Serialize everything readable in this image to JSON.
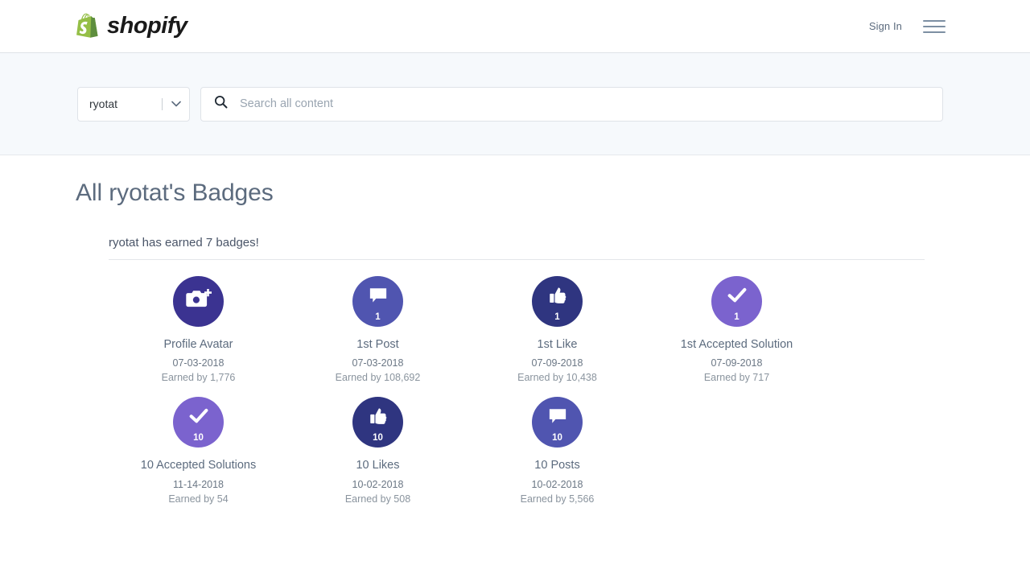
{
  "header": {
    "brand_name": "shopify",
    "brand_icon": "shopify-bag-logo",
    "brand_color": "#95BF47",
    "signin_label": "Sign In",
    "menu_icon": "hamburger-menu-icon"
  },
  "search": {
    "user_scope_value": "ryotat",
    "dropdown_icon": "chevron-down-icon",
    "search_icon": "search-icon",
    "placeholder": "Search all content",
    "value": ""
  },
  "main": {
    "page_title": "All ryotat's Badges",
    "summary": "ryotat has earned 7 badges!"
  },
  "badges": [
    {
      "name": "Profile Avatar",
      "date": "07-03-2018",
      "earned_by": "Earned by 1,776",
      "icon": "camera-plus-icon",
      "count": "",
      "color": "#3b3391"
    },
    {
      "name": "1st Post",
      "date": "07-03-2018",
      "earned_by": "Earned by 108,692",
      "icon": "speech-bubble-icon",
      "count": "1",
      "color": "#5055b0"
    },
    {
      "name": "1st Like",
      "date": "07-09-2018",
      "earned_by": "Earned by 10,438",
      "icon": "thumbs-up-icon",
      "count": "1",
      "color": "#2f3580"
    },
    {
      "name": "1st Accepted Solution",
      "date": "07-09-2018",
      "earned_by": "Earned by 717",
      "icon": "checkmark-icon",
      "count": "1",
      "color": "#7b63ce"
    },
    {
      "name": "10 Accepted Solutions",
      "date": "11-14-2018",
      "earned_by": "Earned by 54",
      "icon": "checkmark-icon",
      "count": "10",
      "color": "#7b63ce"
    },
    {
      "name": "10 Likes",
      "date": "10-02-2018",
      "earned_by": "Earned by 508",
      "icon": "thumbs-up-icon",
      "count": "10",
      "color": "#2f3580"
    },
    {
      "name": "10 Posts",
      "date": "10-02-2018",
      "earned_by": "Earned by 5,566",
      "icon": "speech-bubble-icon",
      "count": "10",
      "color": "#5055b0"
    }
  ]
}
